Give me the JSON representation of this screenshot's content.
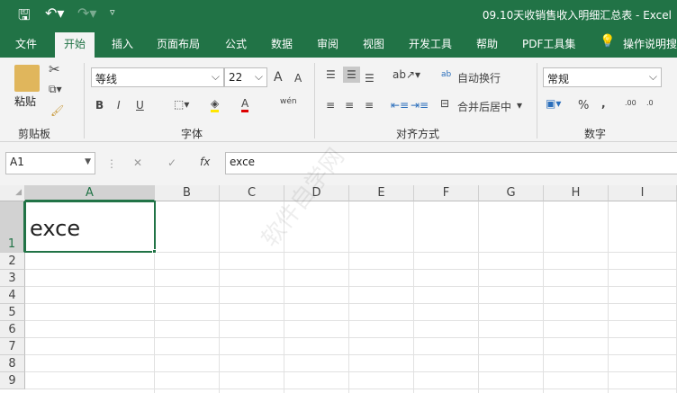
{
  "title": "09.10天收销售收入明细汇总表  -  Excel",
  "quick_access": {
    "save": "save-icon",
    "undo": "undo-icon",
    "redo": "redo-icon",
    "customize": "customize-icon"
  },
  "tabs": [
    "文件",
    "开始",
    "插入",
    "页面布局",
    "公式",
    "数据",
    "审阅",
    "视图",
    "开发工具",
    "帮助",
    "PDF工具集"
  ],
  "tell_me": "操作说明搜",
  "ribbon": {
    "clipboard": {
      "paste": "粘贴",
      "label": "剪贴板"
    },
    "font": {
      "name": "等线",
      "size": "22",
      "bold": "B",
      "italic": "I",
      "underline": "U",
      "grow": "A",
      "shrink": "A",
      "font_color": "A",
      "phonetic": "wén",
      "label": "字体"
    },
    "alignment": {
      "wrap": "自动换行",
      "merge": "合并后居中",
      "label": "对齐方式"
    },
    "number": {
      "format": "常规",
      "percent": "%",
      "comma": ",",
      "inc": ".00",
      "dec": ".0",
      "label": "数字"
    }
  },
  "formula_bar": {
    "name_box": "A1",
    "cancel": "✕",
    "enter": "✓",
    "fx": "fx",
    "value": "exce"
  },
  "columns": [
    "A",
    "B",
    "C",
    "D",
    "E",
    "F",
    "G",
    "H",
    "I"
  ],
  "rows": [
    "1",
    "2",
    "3",
    "4",
    "5",
    "6",
    "7",
    "8",
    "9"
  ],
  "cells": {
    "A1": "exce"
  },
  "watermark": "软件自学网 WWW.RJZXW.COM"
}
